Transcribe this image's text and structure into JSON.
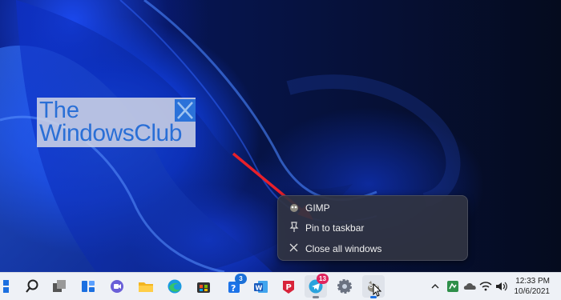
{
  "logo": {
    "line1": "The",
    "line2": "WindowsClub"
  },
  "jump_list": {
    "items": [
      {
        "icon": "gimp-icon",
        "label": "GIMP"
      },
      {
        "icon": "pin-icon",
        "label": "Pin to taskbar"
      },
      {
        "icon": "close-icon",
        "label": "Close all windows"
      }
    ]
  },
  "taskbar": {
    "apps": [
      {
        "name": "start-icon"
      },
      {
        "name": "search-icon"
      },
      {
        "name": "task-view-icon"
      },
      {
        "name": "widgets-icon"
      },
      {
        "name": "teams-chat-icon"
      },
      {
        "name": "file-explorer-icon"
      },
      {
        "name": "edge-icon"
      },
      {
        "name": "store-icon"
      },
      {
        "name": "word-blue-icon",
        "badge": "3"
      },
      {
        "name": "word-icon"
      },
      {
        "name": "app-p-icon"
      },
      {
        "name": "telegram-icon",
        "badge": "13"
      },
      {
        "name": "settings-icon"
      },
      {
        "name": "gimp-icon"
      }
    ],
    "tray": {
      "time": "12:33 PM",
      "date": "10/6/2021"
    }
  },
  "colors": {
    "accent": "#2a6fd6",
    "badge": "#e0245e",
    "arrow": "#e8202a"
  }
}
